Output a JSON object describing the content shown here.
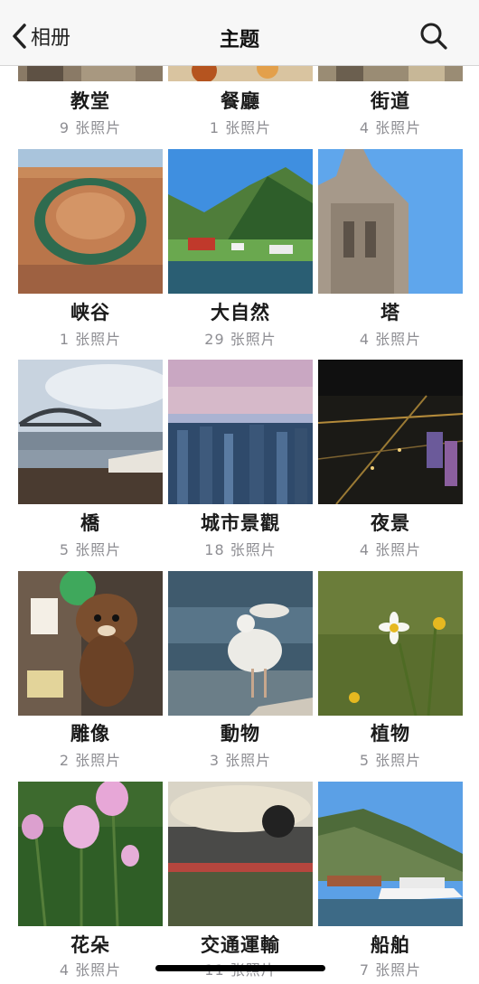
{
  "nav": {
    "back_label": "相册",
    "title": "主题"
  },
  "categories": [
    {
      "label": "教堂",
      "count": "9 张照片"
    },
    {
      "label": "餐廳",
      "count": "1 张照片"
    },
    {
      "label": "街道",
      "count": "4 张照片"
    },
    {
      "label": "峡谷",
      "count": "1 张照片"
    },
    {
      "label": "大自然",
      "count": "29 张照片"
    },
    {
      "label": "塔",
      "count": "4 张照片"
    },
    {
      "label": "橋",
      "count": "5 张照片"
    },
    {
      "label": "城市景觀",
      "count": "18 张照片"
    },
    {
      "label": "夜景",
      "count": "4 张照片"
    },
    {
      "label": "雕像",
      "count": "2 张照片"
    },
    {
      "label": "動物",
      "count": "3 张照片"
    },
    {
      "label": "植物",
      "count": "5 张照片"
    },
    {
      "label": "花朵",
      "count": "4 张照片"
    },
    {
      "label": "交通運輸",
      "count": "11 张照片"
    },
    {
      "label": "船舶",
      "count": "7 张照片"
    }
  ],
  "colors": {
    "nav_bg": "#f7f7f7",
    "count_gray": "#8e8e93"
  }
}
